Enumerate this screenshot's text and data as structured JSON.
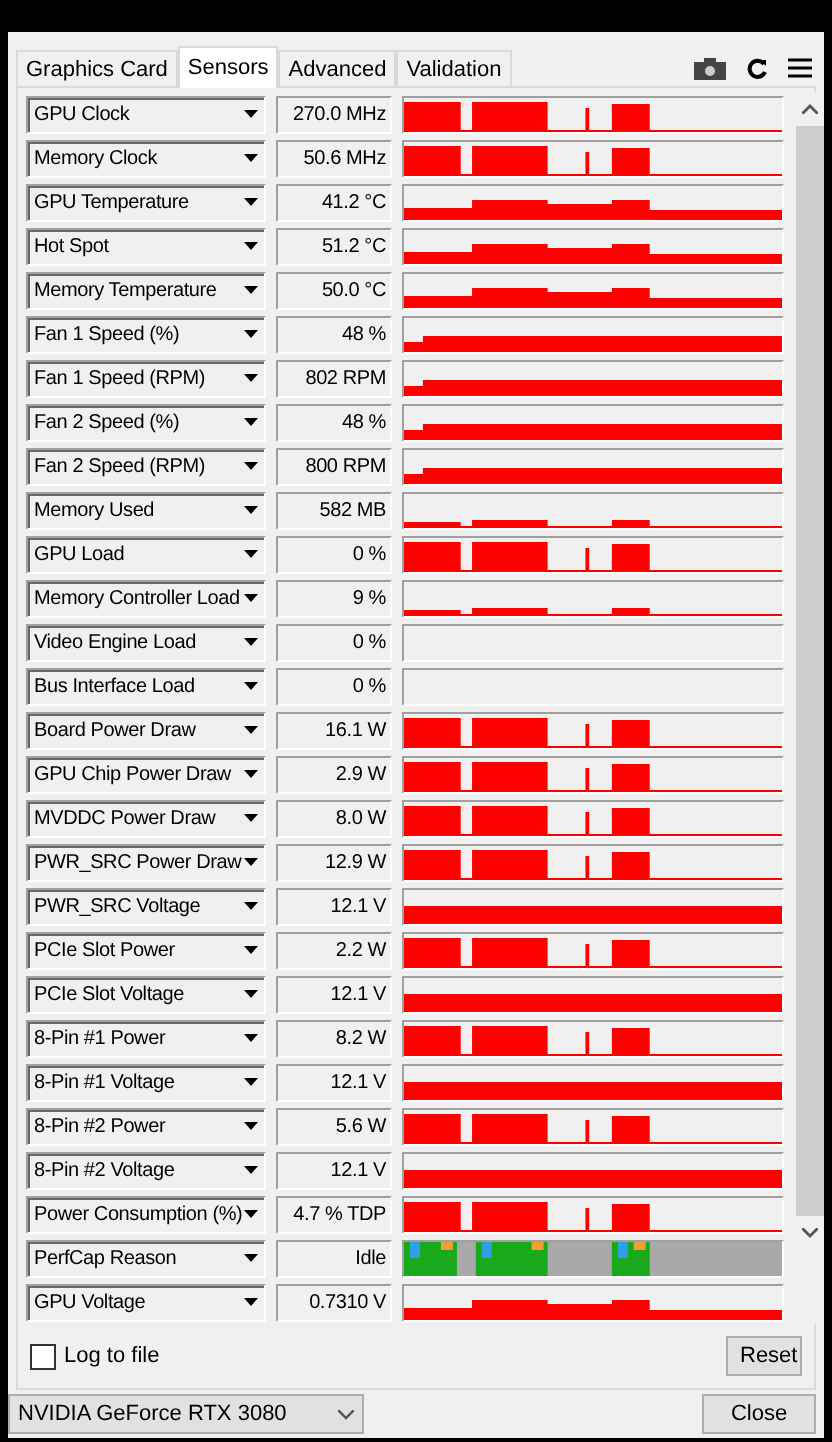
{
  "tabs": [
    {
      "label": "Graphics Card",
      "selected": false
    },
    {
      "label": "Sensors",
      "selected": true
    },
    {
      "label": "Advanced",
      "selected": false
    },
    {
      "label": "Validation",
      "selected": false
    }
  ],
  "sensors": [
    {
      "name": "GPU Clock",
      "value": "270.0 MHz",
      "kind": "bursts"
    },
    {
      "name": "Memory Clock",
      "value": "50.6 MHz",
      "kind": "bursts"
    },
    {
      "name": "GPU Temperature",
      "value": "41.2 °C",
      "kind": "plateau"
    },
    {
      "name": "Hot Spot",
      "value": "51.2 °C",
      "kind": "plateau"
    },
    {
      "name": "Memory Temperature",
      "value": "50.0 °C",
      "kind": "plateau"
    },
    {
      "name": "Fan 1 Speed (%)",
      "value": "48 %",
      "kind": "flat"
    },
    {
      "name": "Fan 1 Speed (RPM)",
      "value": "802 RPM",
      "kind": "flat"
    },
    {
      "name": "Fan 2 Speed (%)",
      "value": "48 %",
      "kind": "flat"
    },
    {
      "name": "Fan 2 Speed (RPM)",
      "value": "800 RPM",
      "kind": "flat"
    },
    {
      "name": "Memory Used",
      "value": "582 MB",
      "kind": "low"
    },
    {
      "name": "GPU Load",
      "value": "0 %",
      "kind": "bursts"
    },
    {
      "name": "Memory Controller Load",
      "value": "9 %",
      "kind": "low"
    },
    {
      "name": "Video Engine Load",
      "value": "0 %",
      "kind": "empty"
    },
    {
      "name": "Bus Interface Load",
      "value": "0 %",
      "kind": "empty"
    },
    {
      "name": "Board Power Draw",
      "value": "16.1 W",
      "kind": "bursts"
    },
    {
      "name": "GPU Chip Power Draw",
      "value": "2.9 W",
      "kind": "bursts"
    },
    {
      "name": "MVDDC Power Draw",
      "value": "8.0 W",
      "kind": "bursts"
    },
    {
      "name": "PWR_SRC Power Draw",
      "value": "12.9 W",
      "kind": "bursts"
    },
    {
      "name": "PWR_SRC Voltage",
      "value": "12.1 V",
      "kind": "full"
    },
    {
      "name": "PCIe Slot Power",
      "value": "2.2 W",
      "kind": "bursts"
    },
    {
      "name": "PCIe Slot Voltage",
      "value": "12.1 V",
      "kind": "full"
    },
    {
      "name": "8-Pin #1 Power",
      "value": "8.2 W",
      "kind": "bursts"
    },
    {
      "name": "8-Pin #1 Voltage",
      "value": "12.1 V",
      "kind": "full"
    },
    {
      "name": "8-Pin #2 Power",
      "value": "5.6 W",
      "kind": "bursts"
    },
    {
      "name": "8-Pin #2 Voltage",
      "value": "12.1 V",
      "kind": "full"
    },
    {
      "name": "Power Consumption (%)",
      "value": "4.7 % TDP",
      "kind": "bursts"
    },
    {
      "name": "PerfCap Reason",
      "value": "Idle",
      "kind": "perfcap"
    },
    {
      "name": "GPU Voltage",
      "value": "0.7310 V",
      "kind": "plateau"
    }
  ],
  "log_to_file": {
    "label": "Log to file",
    "checked": false
  },
  "reset_button": "Reset",
  "gpu_select": "NVIDIA GeForce RTX 3080",
  "close_button": "Close"
}
